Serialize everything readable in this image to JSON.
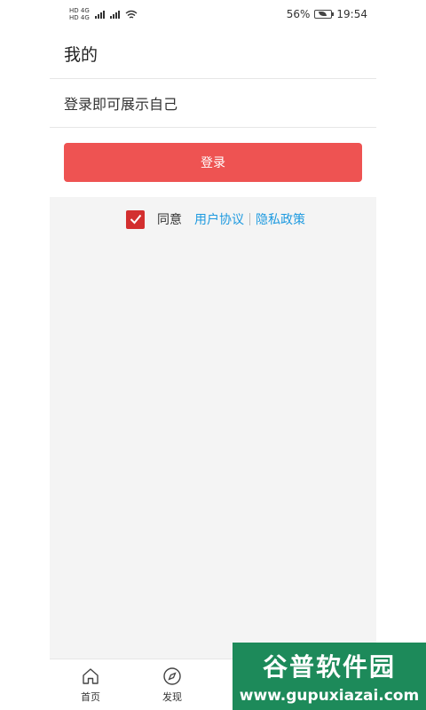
{
  "status_bar": {
    "network_top": "HD 4G",
    "network_bottom": "HD 4G",
    "battery": "56%",
    "time": "19:54"
  },
  "header": {
    "title": "我的"
  },
  "profile": {
    "prompt": "登录即可展示自己"
  },
  "login": {
    "label": "登录"
  },
  "agreement": {
    "checked": true,
    "agree_label": "同意",
    "user_agreement": "用户协议",
    "privacy_policy": "隐私政策"
  },
  "bottom_nav": {
    "items": [
      {
        "label": "首页",
        "icon": "home-icon"
      },
      {
        "label": "发现",
        "icon": "compass-icon"
      },
      {
        "label": "",
        "icon": ""
      },
      {
        "label": "",
        "icon": ""
      }
    ]
  },
  "watermark": {
    "title": "谷普软件园",
    "url": "www.gupuxiazai.com"
  },
  "colors": {
    "accent": "#ee5352",
    "checkbox": "#d32f2f",
    "link": "#1e9ae0",
    "background_gray": "#f4f4f4"
  }
}
